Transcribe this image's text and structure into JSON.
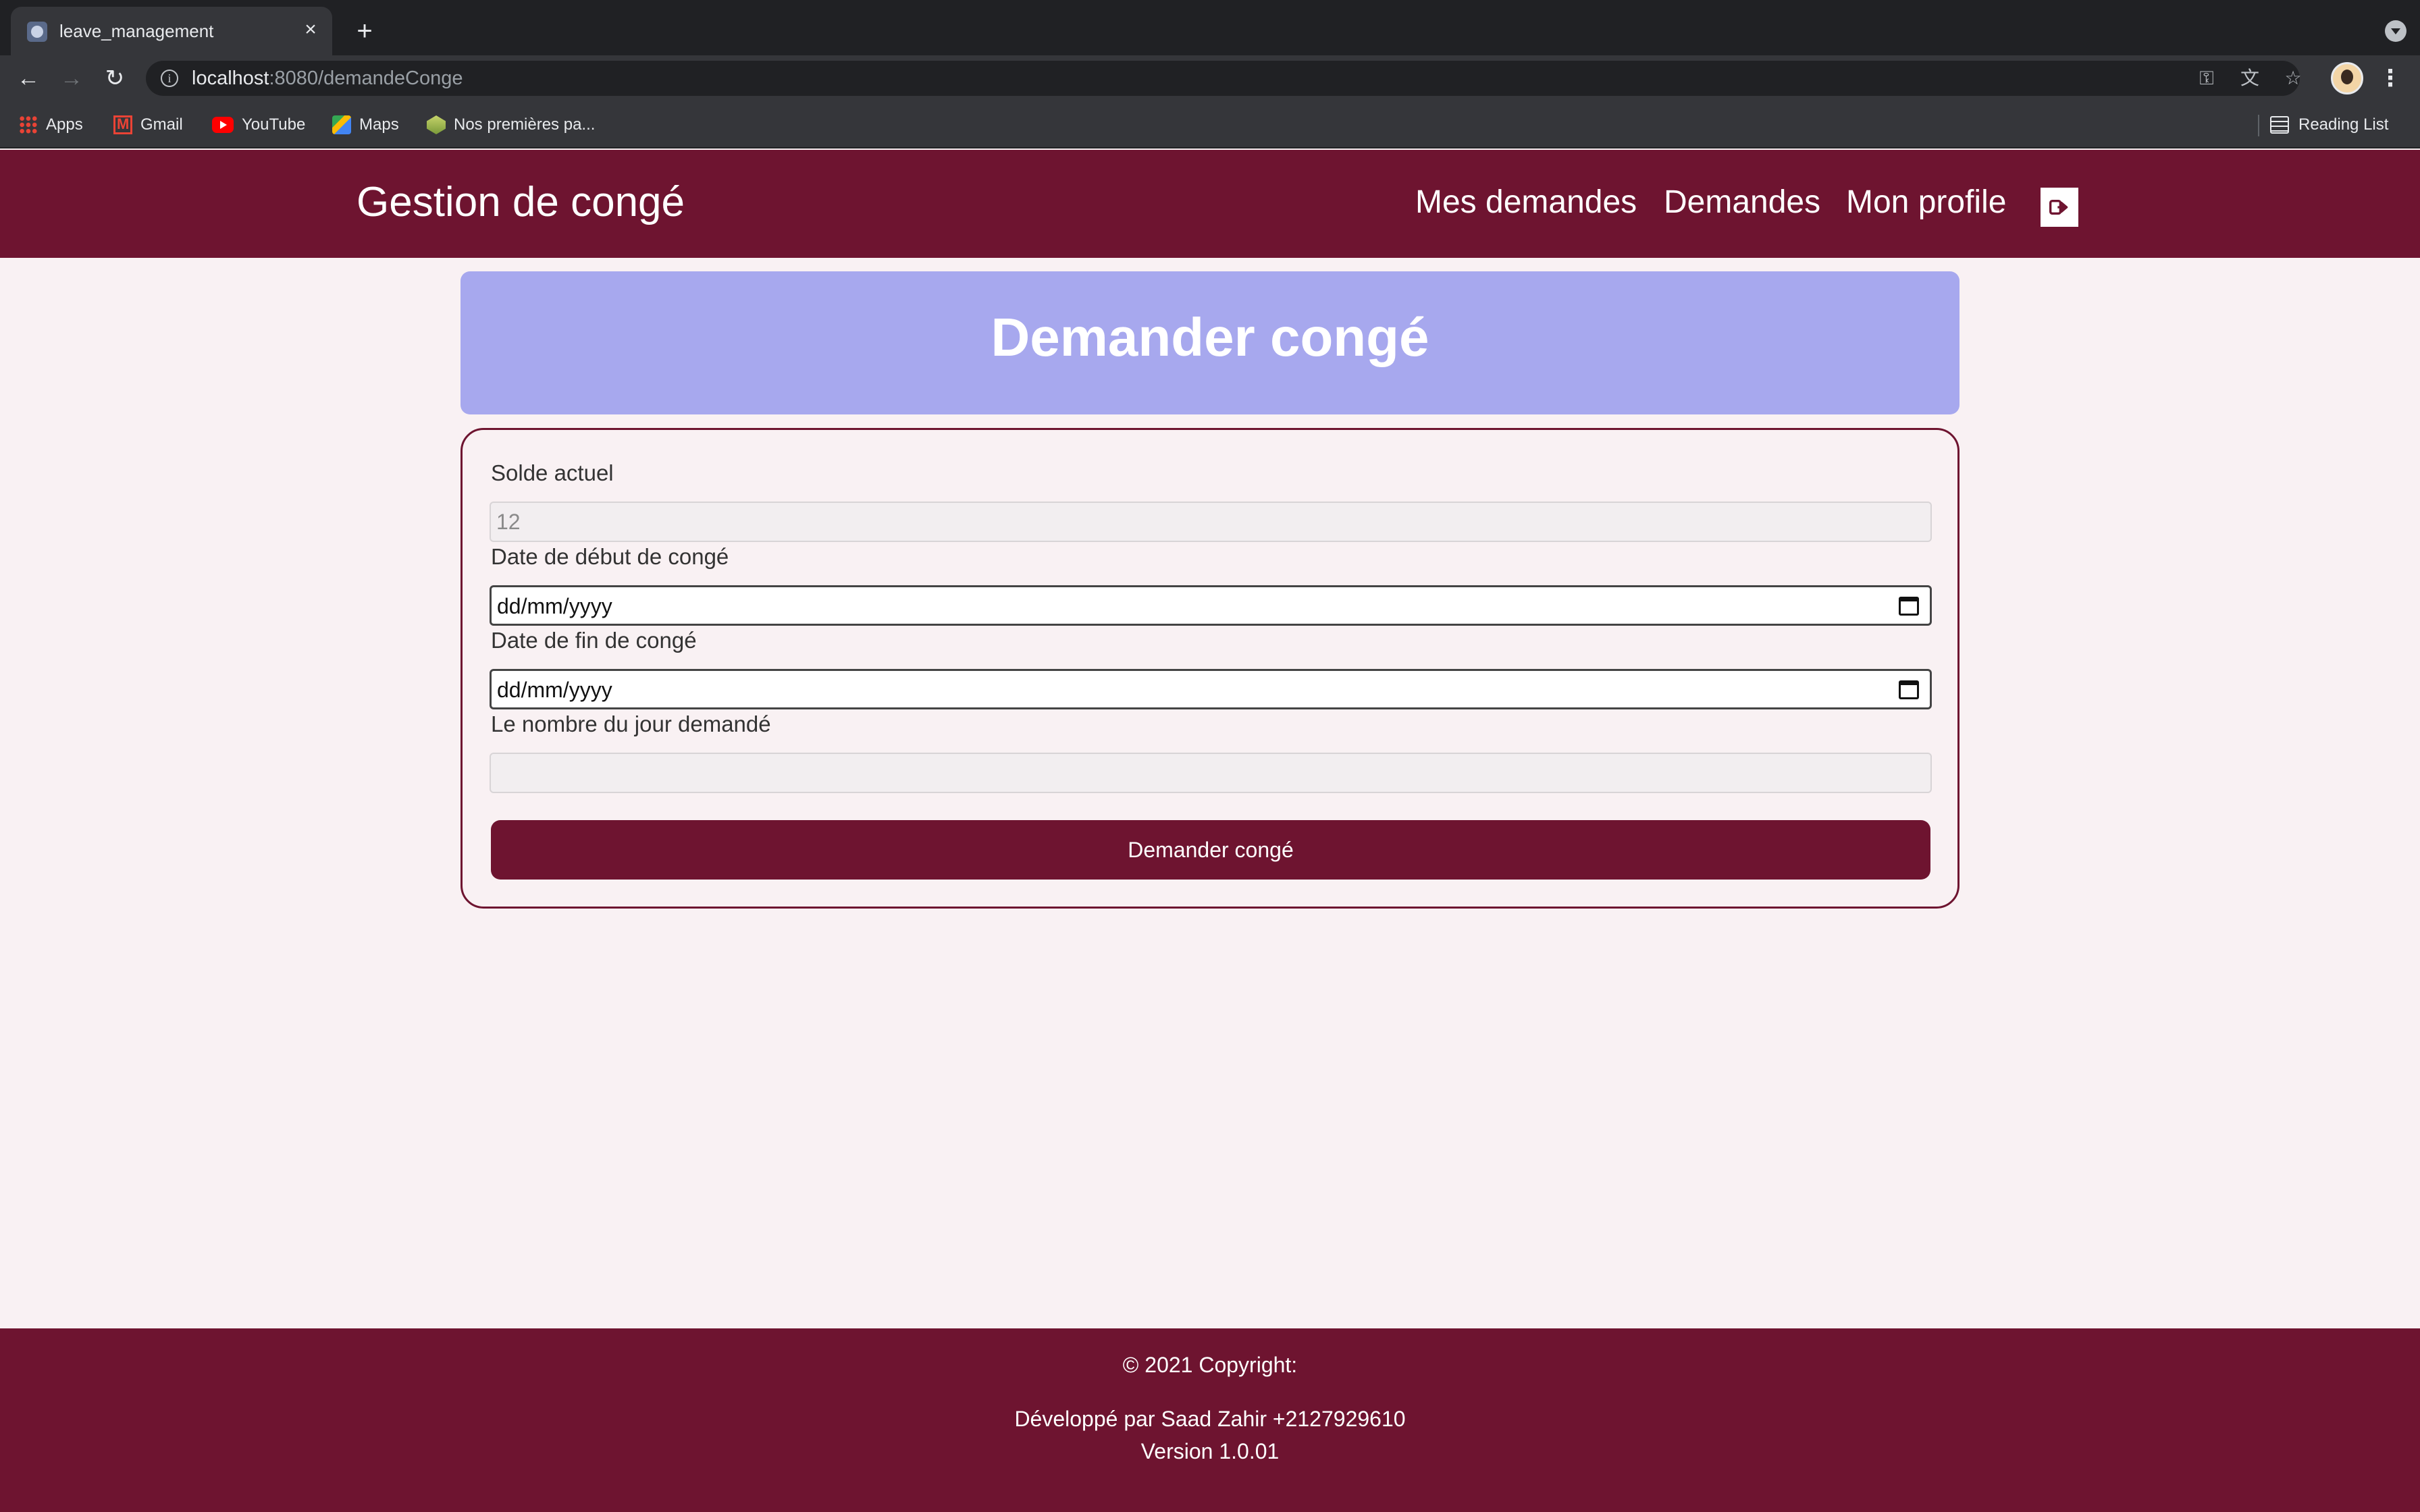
{
  "browser": {
    "tab_title": "leave_management",
    "url_host": "localhost",
    "url_rest": ":8080/demandeConge",
    "bookmarks": [
      "Apps",
      "Gmail",
      "YouTube",
      "Maps",
      "Nos premières pa..."
    ],
    "reading_list": "Reading List"
  },
  "navbar": {
    "brand": "Gestion de congé",
    "links": [
      "Mes demandes",
      "Demandes",
      "Mon profile"
    ]
  },
  "header": {
    "title": "Demander congé"
  },
  "form": {
    "balance_label": "Solde actuel",
    "balance_value": "12",
    "start_label": "Date de début de congé",
    "start_placeholder": "dd/mm/yyyy",
    "end_label": "Date de fin de congé",
    "end_placeholder": "dd/mm/yyyy",
    "days_label": "Le nombre du jour demandé",
    "days_value": "",
    "submit_label": "Demander congé"
  },
  "footer": {
    "copyright": "© 2021 Copyright:",
    "developer": "Développé par Saad Zahir +2127929610",
    "version": "Version 1.0.01"
  },
  "colors": {
    "primary": "#6e1430",
    "header_card": "#a7a8ee",
    "page_background": "#f9f1f3"
  }
}
